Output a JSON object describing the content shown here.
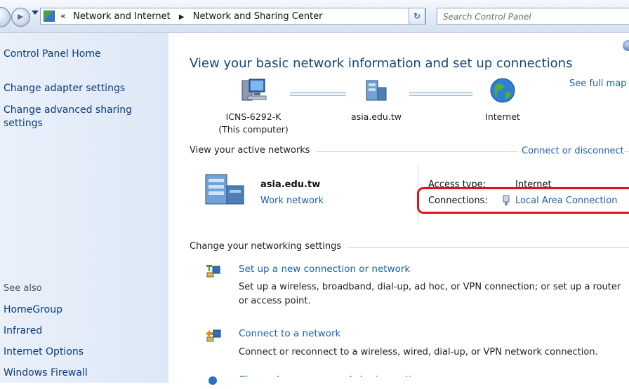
{
  "address_bar": {
    "breadcrumbs": [
      "Network and Internet",
      "Network and Sharing Center"
    ],
    "overflow_marker": "«",
    "search_placeholder": "Search Control Panel"
  },
  "sidebar": {
    "primary_links": [
      "Control Panel Home",
      "Change adapter settings",
      "Change advanced sharing settings"
    ],
    "see_also_heading": "See also",
    "see_also_links": [
      "HomeGroup",
      "Infrared",
      "Internet Options",
      "Windows Firewall"
    ]
  },
  "main": {
    "title": "View your basic network information and set up connections",
    "see_full_map": "See full map",
    "network_map": {
      "computer_name": "ICNS-6292-K",
      "computer_caption": "(This computer)",
      "network_name": "asia.edu.tw",
      "internet_label": "Internet"
    },
    "active_networks": {
      "heading": "View your active networks",
      "connect_link": "Connect or disconnect",
      "network_name": "asia.edu.tw",
      "network_type": "Work network",
      "access_type_label": "Access type:",
      "access_type_value": "Internet",
      "connections_label": "Connections:",
      "connections_value": "Local Area Connection"
    },
    "settings": {
      "heading": "Change your networking settings",
      "tasks": [
        {
          "title": "Set up a new connection or network",
          "description": "Set up a wireless, broadband, dial-up, ad hoc, or VPN connection; or set up a router or access point."
        },
        {
          "title": "Connect to a network",
          "description": "Connect or reconnect to a wireless, wired, dial-up, or VPN network connection."
        },
        {
          "title": "Choose homegroup and sharing options",
          "description": ""
        }
      ]
    }
  },
  "colors": {
    "link": "#1a5fb4",
    "title": "#13457a",
    "sidebar_link": "#0d3a78",
    "highlight": "#e3111b"
  }
}
